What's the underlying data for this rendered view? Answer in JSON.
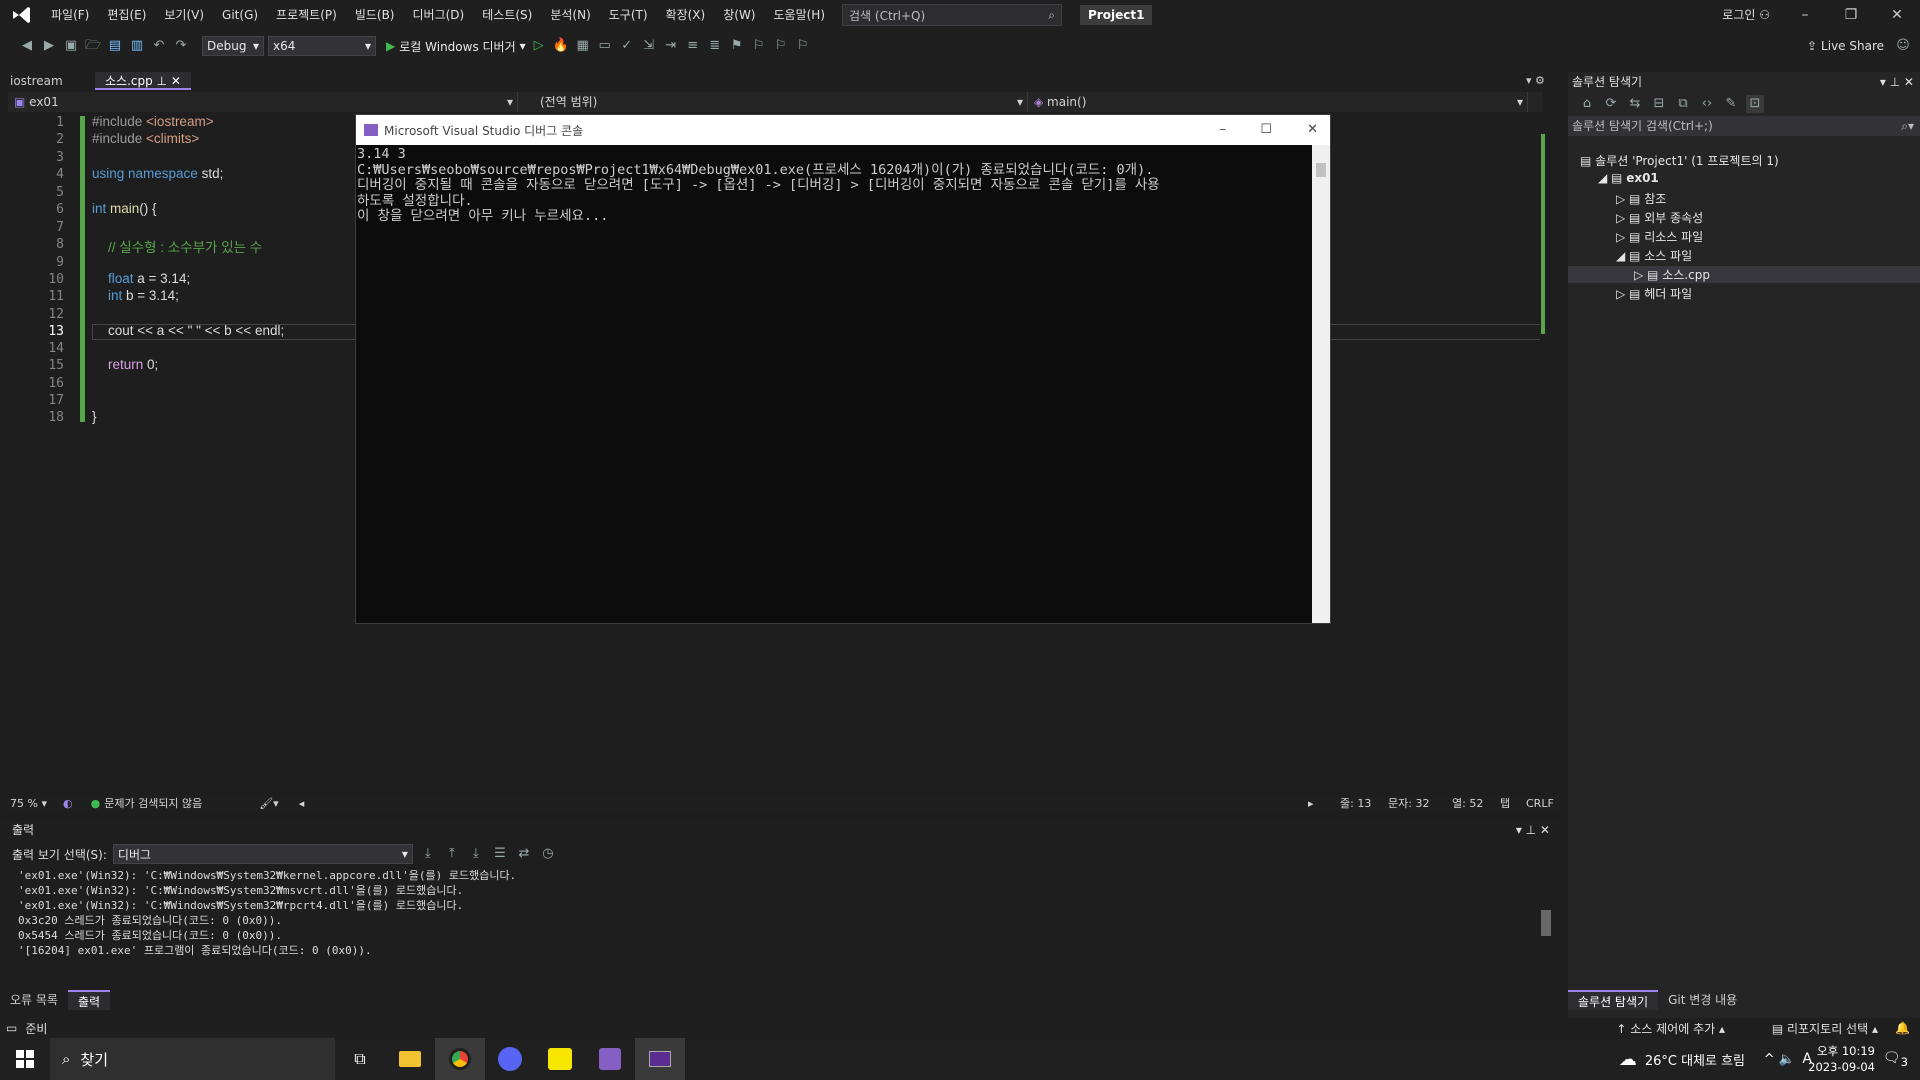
{
  "menu": {
    "items": [
      "파일(F)",
      "편집(E)",
      "보기(V)",
      "Git(G)",
      "프로젝트(P)",
      "빌드(B)",
      "디버그(D)",
      "테스트(S)",
      "분석(N)",
      "도구(T)",
      "확장(X)",
      "창(W)",
      "도움말(H)"
    ],
    "search_placeholder": "검색 (Ctrl+Q)",
    "project_name": "Project1",
    "login": "로그인"
  },
  "toolbar": {
    "config": "Debug",
    "platform": "x64",
    "run_label": "로컬 Windows 디버거",
    "live_share": "Live Share"
  },
  "doc_tabs": [
    {
      "label": "iostream",
      "active": false
    },
    {
      "label": "소스.cpp",
      "active": true
    }
  ],
  "navbar": {
    "project": "ex01",
    "scope": "(전역 범위)",
    "member": "main()"
  },
  "editor": {
    "line_numbers": [
      "1",
      "2",
      "3",
      "4",
      "5",
      "6",
      "7",
      "8",
      "9",
      "10",
      "11",
      "12",
      "13",
      "14",
      "15",
      "16",
      "17",
      "18"
    ],
    "current_line": "13",
    "code": {
      "l1_pp": "#include ",
      "l1_inc": "<iostream>",
      "l2_pp": "#include ",
      "l2_inc": "<climits>",
      "l4_kw": "using namespace ",
      "l4_rest": "std;",
      "l6_kw": "int ",
      "l6_fn": "main",
      "l6_rest": "() {",
      "l8_cm": "// 실수형 : 소수부가 있는 수",
      "l10_kw": "float ",
      "l10_rest": "a = 3.14;",
      "l11_kw": "int ",
      "l11_rest": "b = 3.14;",
      "l13": "cout << a << \" \" << b << endl;",
      "l15_kw": "return ",
      "l15_rest": "0;",
      "l18": "}"
    }
  },
  "console": {
    "title": "Microsoft Visual Studio 디버그 콘솔",
    "lines": [
      "3.14 3",
      "",
      "C:₩Users₩seobo₩source₩repos₩Project1₩x64₩Debug₩ex01.exe(프로세스 16204개)이(가) 종료되었습니다(코드: 0개).",
      "디버깅이 중지될 때 콘솔을 자동으로 닫으려면 [도구] -> [옵션] -> [디버깅] > [디버깅이 중지되면 자동으로 콘솔 닫기]를 사용",
      "하도록 설정합니다.",
      "이 창을 닫으려면 아무 키나 누르세요..."
    ]
  },
  "status_strip": {
    "zoom": "75 %",
    "issues": "문제가 검색되지 않음",
    "line": "줄: 13",
    "char": "문자: 32",
    "col": "열: 52",
    "tab": "탭",
    "eol": "CRLF"
  },
  "output": {
    "title": "출력",
    "source_label": "출력 보기 선택(S):",
    "source_value": "디버그",
    "lines": [
      "'ex01.exe'(Win32): 'C:₩Windows₩System32₩kernel.appcore.dll'을(를) 로드했습니다.",
      "'ex01.exe'(Win32): 'C:₩Windows₩System32₩msvcrt.dll'을(를) 로드했습니다.",
      "'ex01.exe'(Win32): 'C:₩Windows₩System32₩rpcrt4.dll'을(를) 로드했습니다.",
      "0x3c20 스레드가 종료되었습니다(코드: 0 (0x0)).",
      "0x5454 스레드가 종료되었습니다(코드: 0 (0x0)).",
      "'[16204] ex01.exe' 프로그램이 종료되었습니다(코드: 0 (0x0))."
    ]
  },
  "bottom_tabs": [
    {
      "label": "오류 목록",
      "active": false
    },
    {
      "label": "출력",
      "active": true
    }
  ],
  "solution": {
    "title": "솔루션 탐색기",
    "search_placeholder": "솔루션 탐색기 검색(Ctrl+;)",
    "tree": [
      {
        "label": "솔루션 'Project1' (1 프로젝트의 1)",
        "depth": 0,
        "bold": false
      },
      {
        "label": "ex01",
        "depth": 1,
        "bold": true
      },
      {
        "label": "참조",
        "depth": 2,
        "bold": false
      },
      {
        "label": "외부 종속성",
        "depth": 2,
        "bold": false
      },
      {
        "label": "리소스 파일",
        "depth": 2,
        "bold": false
      },
      {
        "label": "소스 파일",
        "depth": 2,
        "bold": false
      },
      {
        "label": "소스.cpp",
        "depth": 3,
        "bold": false
      },
      {
        "label": "헤더 파일",
        "depth": 2,
        "bold": false
      }
    ],
    "tabs": [
      "솔루션 탐색기",
      "Git 변경 내용"
    ]
  },
  "ide_status": {
    "ready": "준비",
    "source_control": "소스 제어에 추가",
    "repo": "리포지토리 선택"
  },
  "taskbar": {
    "search": "찾기",
    "weather": "26°C 대체로 흐림",
    "ime": "A",
    "time": "오후 10:19",
    "date": "2023-09-04",
    "notif_count": "3"
  },
  "colors": {
    "accent": "#9b84ec",
    "vs_purple": "#865fc5",
    "green_bar": "#57a64a"
  }
}
